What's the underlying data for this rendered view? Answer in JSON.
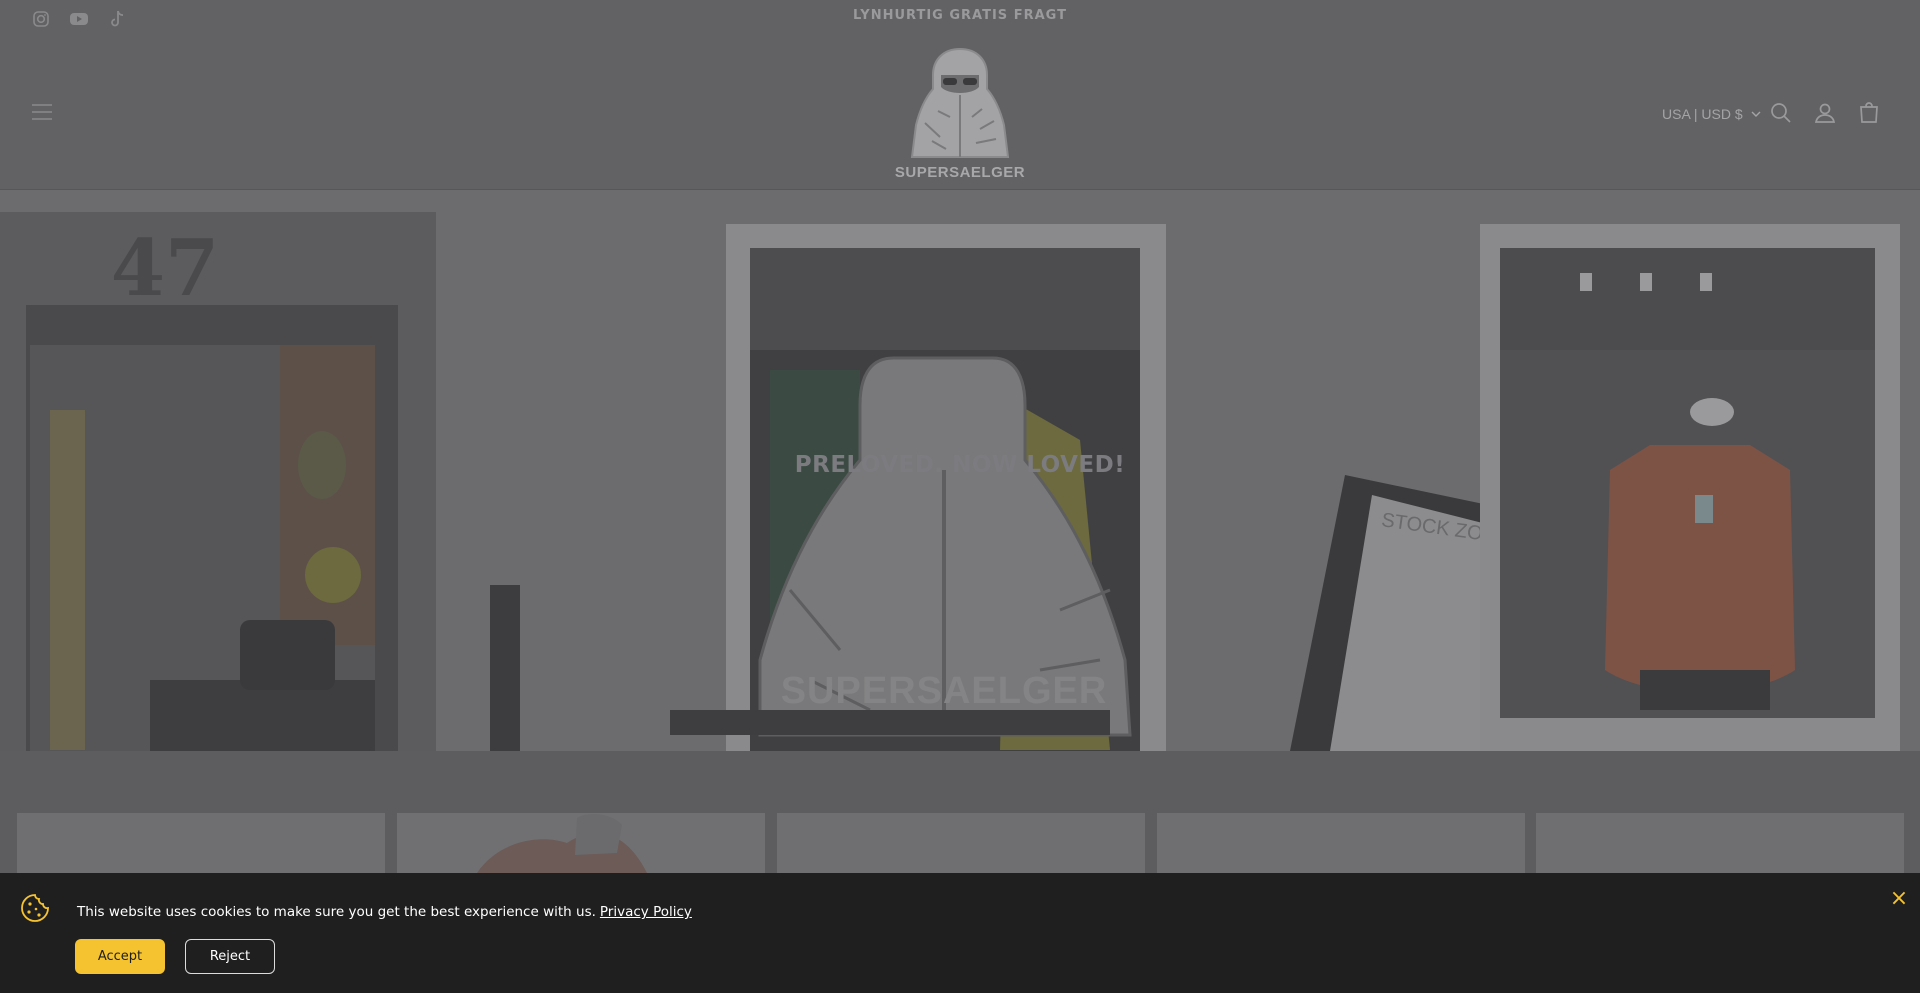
{
  "announcement": {
    "text": "LYNHURTIG GRATIS FRAGT"
  },
  "social": [
    {
      "icon": "instagram-icon"
    },
    {
      "icon": "youtube-icon"
    },
    {
      "icon": "tiktok-icon"
    }
  ],
  "header": {
    "logo_text": "SUPERSAELGER",
    "country_selector": "USA | USD $"
  },
  "hero": {
    "title": "PRELOVED. NOW LOVED!",
    "scene_texts": {
      "shop_number": "47",
      "window_logo": "SUPERSAELGER",
      "sign": "STOCK ZONE"
    }
  },
  "cookie_banner": {
    "message": "This website uses cookies to make sure you get the best experience with us.",
    "link_label": "Privacy Policy",
    "accept_label": "Accept",
    "reject_label": "Reject",
    "close_label": "×"
  },
  "colors": {
    "overlay_dark": "#1f1f1f",
    "accent_yellow": "#f5c330"
  }
}
